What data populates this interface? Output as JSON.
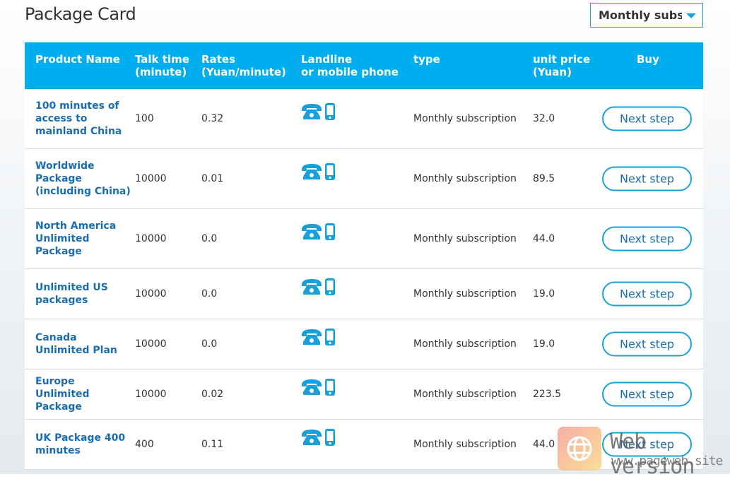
{
  "page": {
    "title": "Package Card",
    "filter_select": {
      "value": "Monthly subscription",
      "display": "Monthly subsc"
    }
  },
  "colors": {
    "header_bg": "#00adef",
    "accent": "#1aa0d8",
    "link": "#1a6db2"
  },
  "table": {
    "headers": {
      "product_name": "Product Name",
      "talk_time_1": "Talk time",
      "talk_time_2": "(minute)",
      "rates_1": "Rates",
      "rates_2": "(Yuan/minute)",
      "device_1": "Landline",
      "device_2": "or mobile phone",
      "type": "type",
      "price_1": "unit price",
      "price_2": "(Yuan)",
      "buy": "Buy"
    },
    "rows": [
      {
        "name": "100 minutes of access to mainland China",
        "talk_time": "100",
        "rate": "0.32",
        "icons": [
          "landline-phone-icon",
          "mobile-phone-icon"
        ],
        "type": "Monthly subscription",
        "price": "32.0",
        "button": "Next step"
      },
      {
        "name": "Worldwide Package (including China)",
        "talk_time": "10000",
        "rate": "0.01",
        "icons": [
          "landline-phone-icon",
          "mobile-phone-icon"
        ],
        "type": "Monthly subscription",
        "price": "89.5",
        "button": "Next step"
      },
      {
        "name": "North America Unlimited Package",
        "talk_time": "10000",
        "rate": "0.0",
        "icons": [
          "landline-phone-icon",
          "mobile-phone-icon"
        ],
        "type": "Monthly subscription",
        "price": "44.0",
        "button": "Next step"
      },
      {
        "name": "Unlimited US packages",
        "talk_time": "10000",
        "rate": "0.0",
        "icons": [
          "landline-phone-icon",
          "mobile-phone-icon"
        ],
        "type": "Monthly subscription",
        "price": "19.0",
        "button": "Next step"
      },
      {
        "name": "Canada Unlimited Plan",
        "talk_time": "10000",
        "rate": "0.0",
        "icons": [
          "landline-phone-icon",
          "mobile-phone-icon"
        ],
        "type": "Monthly subscription",
        "price": "19.0",
        "button": "Next step"
      },
      {
        "name": "Europe Unlimited Package",
        "talk_time": "10000",
        "rate": "0.02",
        "icons": [
          "landline-phone-icon",
          "mobile-phone-icon"
        ],
        "type": "Monthly subscription",
        "price": "223.5",
        "button": "Next step"
      },
      {
        "name": "UK Package 400 minutes",
        "talk_time": "400",
        "rate": "0.11",
        "icons": [
          "landline-phone-icon",
          "mobile-phone-icon"
        ],
        "type": "Monthly subscription",
        "price": "44.0",
        "button": "Next step"
      }
    ]
  },
  "watermark": {
    "title": "Web version",
    "url": "www.pageweb.site",
    "icon": "globe-icon"
  }
}
